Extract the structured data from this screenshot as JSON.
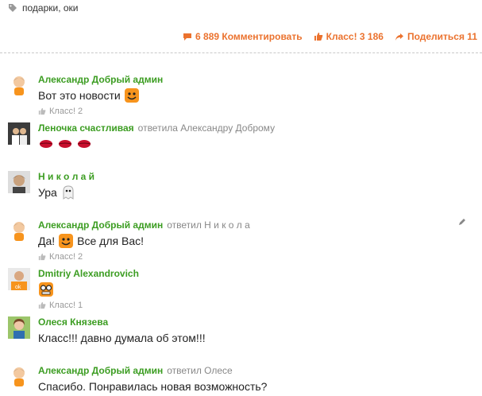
{
  "tags": {
    "label": "подарки, оки"
  },
  "actions": {
    "comments_label": "6 889 Комментировать",
    "class_label": "Класс! 3 186",
    "share_label": "Поделиться 11"
  },
  "colors": {
    "accent": "#eb722e",
    "author": "#3c9d22",
    "muted": "#999999"
  },
  "comments": [
    {
      "author": "Александр Добрый админ",
      "reply_to": "",
      "text": "Вот это новости",
      "emoji": "smile-emoji",
      "like": "Класс! 2"
    },
    {
      "author": "Леночка счастливая",
      "reply_to": "ответила Александру Доброму",
      "text": "",
      "emoji": "kiss-emoji",
      "like": ""
    },
    {
      "author": "Н и к о л а й",
      "reply_to": "",
      "text": "Ура",
      "emoji": "ghost-emoji",
      "like": ""
    },
    {
      "author": "Александр Добрый админ",
      "reply_to": "ответил Н и к о л а",
      "text_before": "Да!",
      "text_after": "Все для Вас!",
      "emoji": "smile-emoji",
      "like": "Класс! 2"
    },
    {
      "author": "Dmitriy Alexandrovich",
      "reply_to": "",
      "text": "",
      "emoji": "glasses-emoji",
      "like": "Класс! 1"
    },
    {
      "author": "Олеся Князева",
      "reply_to": "",
      "text": "Класс!!! давно думала об этом!!!",
      "emoji": "",
      "like": ""
    },
    {
      "author": "Александр Добрый админ",
      "reply_to": "ответил Олесе",
      "text": "Спасибо. Понравилась новая возможность?",
      "emoji": "",
      "like": ""
    }
  ]
}
